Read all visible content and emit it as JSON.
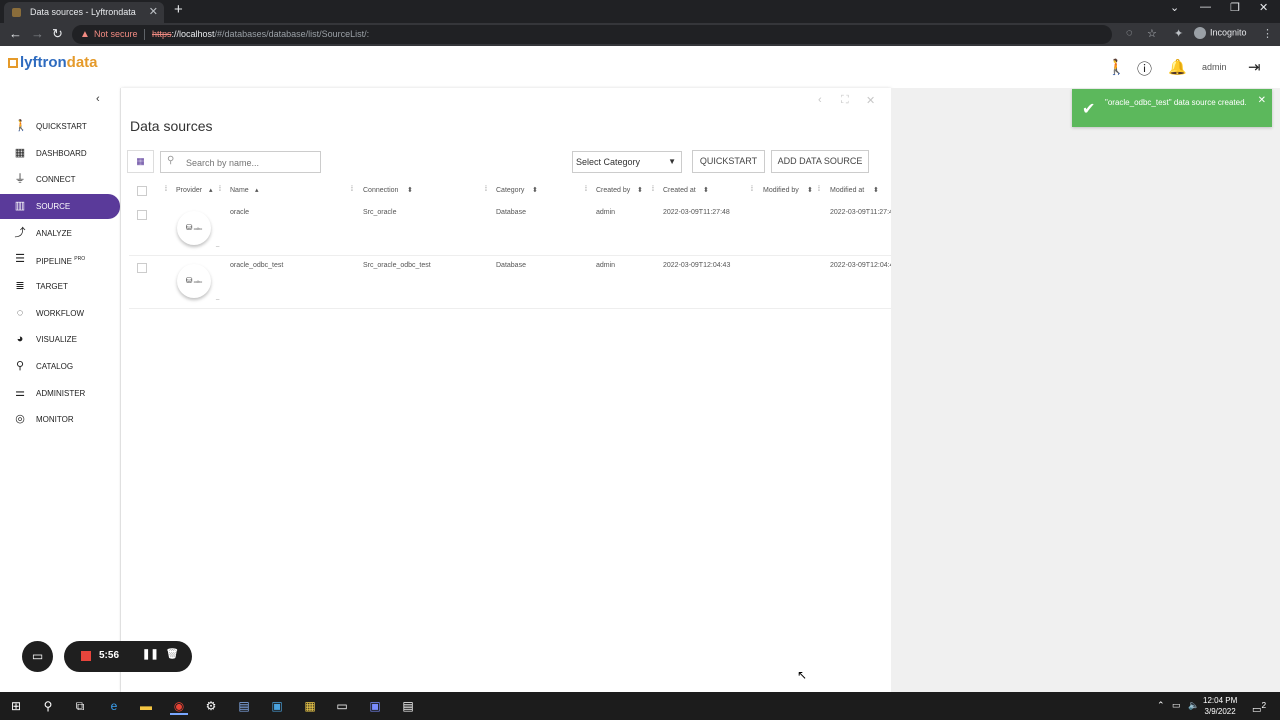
{
  "browser": {
    "tab_title": "Data sources - Lyftrondata",
    "tab_close": "✕",
    "new_tab": "+",
    "not_secure": "Not secure",
    "url_scheme": "https",
    "url_host": "://localhost",
    "url_path": "/#/databases/database/list/SourceList/:",
    "incognito_label": "Incognito"
  },
  "app": {
    "logo_part1": "lyftron",
    "logo_part2": "data",
    "user": "admin"
  },
  "sidebar": {
    "items": [
      {
        "label": "QUICKSTART",
        "icon": "walk-icon"
      },
      {
        "label": "DASHBOARD",
        "icon": "dashboard-icon"
      },
      {
        "label": "CONNECT",
        "icon": "plug-icon"
      },
      {
        "label": "SOURCE",
        "icon": "source-grid-icon"
      },
      {
        "label": "ANALYZE",
        "icon": "trend-icon"
      },
      {
        "label": "PIPELINE",
        "badge": "PRO",
        "icon": "pipeline-icon"
      },
      {
        "label": "TARGET",
        "icon": "target-list-icon"
      },
      {
        "label": "WORKFLOW",
        "icon": "workflow-icon"
      },
      {
        "label": "VISUALIZE",
        "icon": "pie-icon"
      },
      {
        "label": "CATALOG",
        "icon": "search-icon"
      },
      {
        "label": "ADMINISTER",
        "icon": "sliders-icon"
      },
      {
        "label": "MONITOR",
        "icon": "radar-icon"
      }
    ],
    "active_index": 3
  },
  "main": {
    "title": "Data sources",
    "search_placeholder": "Search by name...",
    "category_select": "Select Category",
    "quickstart_button": "QUICKSTART",
    "add_button": "ADD DATA SOURCE",
    "columns": [
      "Provider",
      "Name",
      "Connection",
      "Category",
      "Created by",
      "Created at",
      "Modified by",
      "Modified at"
    ],
    "rows": [
      {
        "provider": "odbc",
        "name": "oracle",
        "connection": "Src_oracle",
        "category": "Database",
        "created_by": "admin",
        "created_at": "2022-03-09T11:27:48",
        "modified_by": "",
        "modified_at": "2022-03-09T11:27:4"
      },
      {
        "provider": "odbc",
        "name": "oracle_odbc_test",
        "connection": "Src_oracle_odbc_test",
        "category": "Database",
        "created_by": "admin",
        "created_at": "2022-03-09T12:04:43",
        "modified_by": "",
        "modified_at": "2022-03-09T12:04:4"
      }
    ],
    "row_dash": "_"
  },
  "toast": {
    "message": "\"oracle_odbc_test\" data source created.",
    "color": "#5cb85c"
  },
  "recorder": {
    "time": "5:56"
  },
  "taskbar": {
    "time": "12:04 PM",
    "date": "3/9/2022",
    "notification_count": "2"
  },
  "colors": {
    "accent": "#5a3a9a",
    "success": "#5cb85c"
  }
}
